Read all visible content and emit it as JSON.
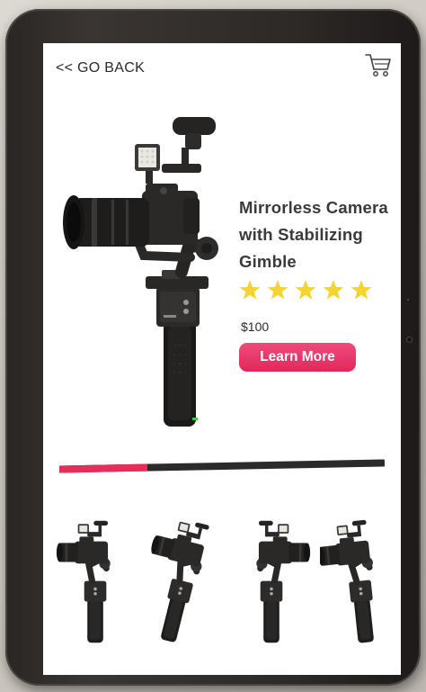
{
  "nav": {
    "back_label": "<< GO BACK",
    "cart_icon": "cart-icon"
  },
  "product": {
    "title_lines": [
      "Mirrorless Camera",
      "with Stabilizing",
      "Gimble"
    ],
    "rating": 5,
    "rating_max": 5,
    "price": "$100",
    "cta_label": "Learn More",
    "image": "camera-gimbal-image"
  },
  "carousel": {
    "progress": 0.27,
    "thumbnails": [
      "gimbal-front-view",
      "gimbal-angled-view",
      "gimbal-side-view",
      "gimbal-rear-view"
    ]
  },
  "colors": {
    "accent": "#e72d5a",
    "star": "#f5d430",
    "track": "#2b2b2b"
  }
}
